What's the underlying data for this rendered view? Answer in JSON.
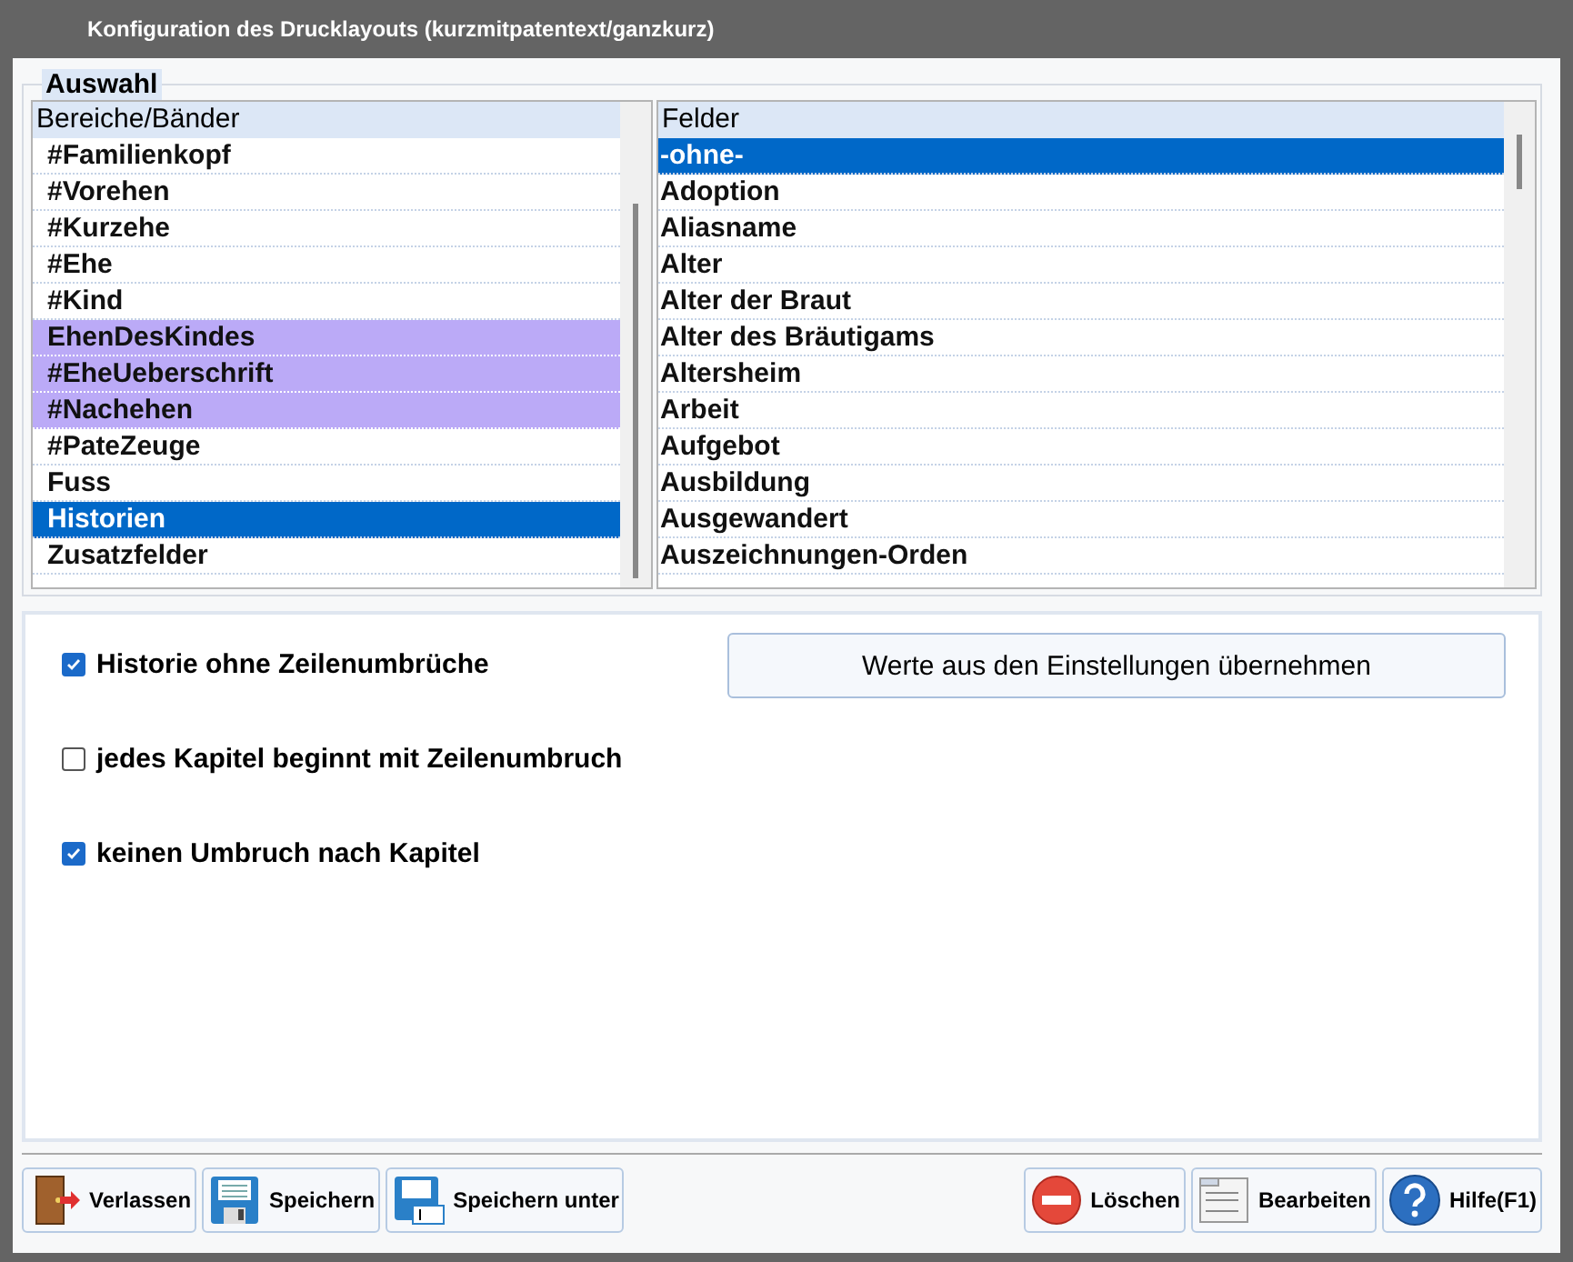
{
  "window": {
    "title": "Konfiguration des Drucklayouts (kurzmitpatentext/ganzkurz)"
  },
  "group": {
    "title": "Auswahl"
  },
  "bands": {
    "header": "Bereiche/Bänder",
    "items": [
      {
        "label": "#Familienkopf",
        "marked": false,
        "selected": false
      },
      {
        "label": "#Vorehen",
        "marked": false,
        "selected": false
      },
      {
        "label": "#Kurzehe",
        "marked": false,
        "selected": false
      },
      {
        "label": "#Ehe",
        "marked": false,
        "selected": false
      },
      {
        "label": "#Kind",
        "marked": false,
        "selected": false
      },
      {
        "label": "EhenDesKindes",
        "marked": true,
        "selected": false
      },
      {
        "label": "#EheUeberschrift",
        "marked": true,
        "selected": false
      },
      {
        "label": "#Nachehen",
        "marked": true,
        "selected": false
      },
      {
        "label": "#PateZeuge",
        "marked": false,
        "selected": false
      },
      {
        "label": "Fuss",
        "marked": false,
        "selected": false
      },
      {
        "label": "Historien",
        "marked": false,
        "selected": true
      },
      {
        "label": "Zusatzfelder",
        "marked": false,
        "selected": false
      }
    ]
  },
  "fields": {
    "header": "Felder",
    "items": [
      {
        "label": "-ohne-",
        "selected": true
      },
      {
        "label": "Adoption",
        "selected": false
      },
      {
        "label": "Aliasname",
        "selected": false
      },
      {
        "label": "Alter",
        "selected": false
      },
      {
        "label": "Alter der Braut",
        "selected": false
      },
      {
        "label": "Alter des Bräutigams",
        "selected": false
      },
      {
        "label": "Altersheim",
        "selected": false
      },
      {
        "label": "Arbeit",
        "selected": false
      },
      {
        "label": "Aufgebot",
        "selected": false
      },
      {
        "label": "Ausbildung",
        "selected": false
      },
      {
        "label": "Ausgewandert",
        "selected": false
      },
      {
        "label": "Auszeichnungen-Orden",
        "selected": false
      }
    ]
  },
  "options": [
    {
      "label": "Historie ohne Zeilenumbrüche",
      "checked": true
    },
    {
      "label": "jedes Kapitel beginnt mit Zeilenumbruch",
      "checked": false
    },
    {
      "label": "keinen Umbruch nach Kapitel",
      "checked": true
    }
  ],
  "apply_button": "Werte aus den Einstellungen übernehmen",
  "buttons_left": [
    {
      "label": "Verlassen",
      "kind": "exit"
    },
    {
      "label": "Speichern",
      "kind": "save"
    },
    {
      "label": "Speichern unter",
      "kind": "saveas"
    }
  ],
  "buttons_right": [
    {
      "label": "Löschen",
      "kind": "delete"
    },
    {
      "label": "Bearbeiten",
      "kind": "edit"
    },
    {
      "label": "Hilfe(F1)",
      "kind": "help"
    }
  ]
}
